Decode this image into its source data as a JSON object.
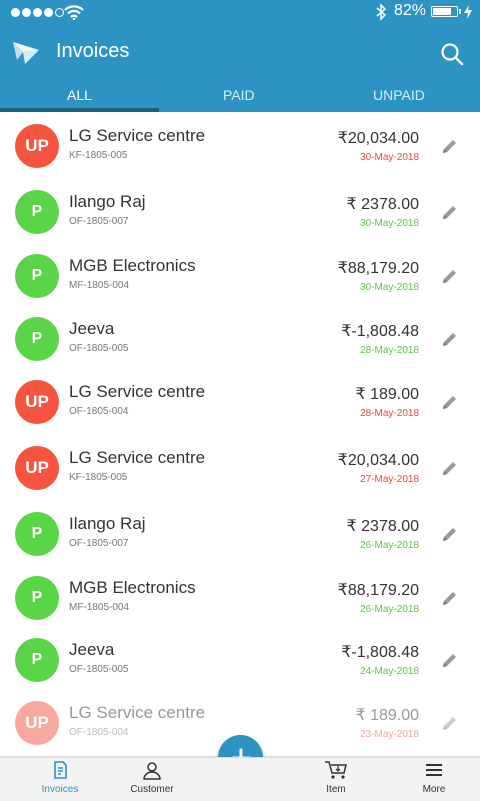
{
  "status": {
    "battery": "82%"
  },
  "header": {
    "title": "Invoices"
  },
  "tabs": [
    {
      "label": "ALL"
    },
    {
      "label": "PAID"
    },
    {
      "label": "UNPAID"
    }
  ],
  "invoices": [
    {
      "badge": "UP",
      "name": "LG Service centre",
      "code": "KF-1805-005",
      "amount": "₹20,034.00",
      "date": "30-May-2018"
    },
    {
      "badge": "P",
      "name": "Ilango Raj",
      "code": "OF-1805-007",
      "amount": "₹ 2378.00",
      "date": "30-May-2018"
    },
    {
      "badge": "P",
      "name": "MGB Electronics",
      "code": "MF-1805-004",
      "amount": "₹88,179.20",
      "date": "30-May-2018"
    },
    {
      "badge": "P",
      "name": "Jeeva",
      "code": "OF-1805-005",
      "amount": "₹-1,808.48",
      "date": "28-May-2018"
    },
    {
      "badge": "UP",
      "name": "LG Service centre",
      "code": "OF-1805-004",
      "amount": "₹ 189.00",
      "date": "28-May-2018"
    },
    {
      "badge": "UP",
      "name": "LG Service centre",
      "code": "KF-1805-005",
      "amount": "₹20,034.00",
      "date": "27-May-2018"
    },
    {
      "badge": "P",
      "name": "Ilango Raj",
      "code": "OF-1805-007",
      "amount": "₹ 2378.00",
      "date": "26-May-2018"
    },
    {
      "badge": "P",
      "name": "MGB Electronics",
      "code": "MF-1805-004",
      "amount": "₹88,179.20",
      "date": "26-May-2018"
    },
    {
      "badge": "P",
      "name": "Jeeva",
      "code": "OF-1805-005",
      "amount": "₹-1,808.48",
      "date": "24-May-2018"
    },
    {
      "badge": "UP",
      "name": "LG Service centre",
      "code": "OF-1805-004",
      "amount": "₹ 189.00",
      "date": "23-May-2018"
    }
  ],
  "bottom_nav": [
    {
      "label": "Invoices",
      "icon": "invoice-icon"
    },
    {
      "label": "Customer",
      "icon": "customer-icon"
    },
    {
      "label": "Item",
      "icon": "cart-icon"
    },
    {
      "label": "More",
      "icon": "menu-icon"
    }
  ],
  "colors": {
    "primary": "#2c93c3",
    "unpaid": "#f5543f",
    "paid": "#5ad548",
    "tab_indicator": "#1c5f7f"
  }
}
